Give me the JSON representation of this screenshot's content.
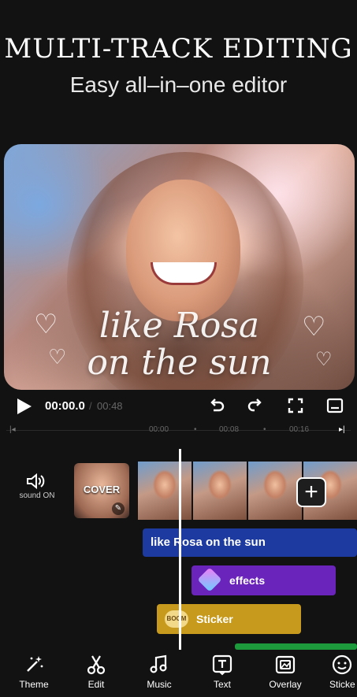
{
  "header": {
    "headline": "MULTI-TRACK EDITING",
    "subline": "Easy all–in–one editor"
  },
  "preview": {
    "caption_line1": "like Rosa",
    "caption_line2": "on the sun"
  },
  "transport": {
    "current_time": "00:00.0",
    "separator": "/",
    "total_time": "00:48"
  },
  "ruler": {
    "marks": [
      "00:00",
      "00:08",
      "00:16"
    ]
  },
  "timeline": {
    "sound_label": "sound ON",
    "cover_label": "COVER",
    "text_track": "like Rosa on the sun",
    "effects_track": "effects",
    "sticker_track": "Sticker",
    "sticker_badge": "BOOM"
  },
  "toolbar": {
    "items": [
      {
        "label": "Theme",
        "icon": "magic-wand-icon"
      },
      {
        "label": "Edit",
        "icon": "scissors-icon"
      },
      {
        "label": "Music",
        "icon": "music-note-icon"
      },
      {
        "label": "Text",
        "icon": "text-icon"
      },
      {
        "label": "Overlay",
        "icon": "overlay-icon"
      },
      {
        "label": "Sticke",
        "icon": "sticker-icon"
      }
    ]
  },
  "colors": {
    "text_track": "#1c3aa0",
    "effects_track": "#6a24bc",
    "sticker_track": "#c79a1d",
    "audio_track": "#1d9a3b"
  }
}
